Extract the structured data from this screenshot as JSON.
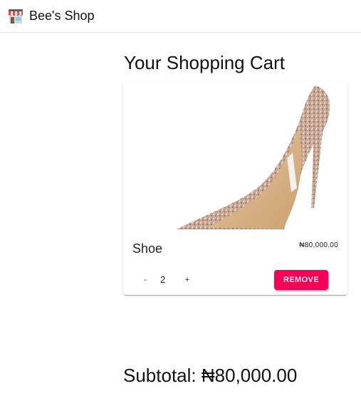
{
  "appbar": {
    "brand_icon": "store-icon",
    "brand_name": "Bee's Shop"
  },
  "page": {
    "title": "Your Shopping Cart"
  },
  "cart": {
    "items": [
      {
        "name": "Shoe",
        "price": "₦80,000.00",
        "quantity": "2",
        "image": "glitter-high-heel-shoe",
        "decrement_label": "-",
        "increment_label": "+",
        "remove_label": "REMOVE"
      }
    ]
  },
  "subtotal": {
    "label": "Subtotal:",
    "value": "₦80,000.00"
  },
  "colors": {
    "accent": "#f50057",
    "divider": "#e6e6e6"
  }
}
